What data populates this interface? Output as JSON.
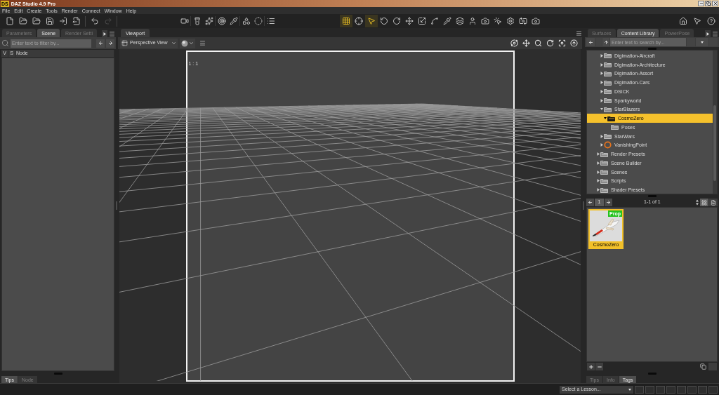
{
  "window": {
    "logo": "DS",
    "title": "DAZ Studio 4.9 Pro"
  },
  "menu": [
    "File",
    "Edit",
    "Create",
    "Tools",
    "Render",
    "Connect",
    "Window",
    "Help"
  ],
  "toolbar": {
    "history": [
      {
        "kind": "undo",
        "disabled": false
      },
      {
        "kind": "redo",
        "disabled": true
      }
    ],
    "tools": [
      {
        "selected": true
      },
      {
        "selected": false
      },
      {
        "selected": true
      },
      {
        "selected": false
      },
      {
        "selected": false
      },
      {
        "selected": false
      },
      {
        "selected": false
      },
      {
        "selected": false
      },
      {
        "selected": false
      },
      {
        "selected": false
      },
      {
        "selected": false
      },
      {
        "selected": false
      },
      {
        "selected": false
      },
      {
        "selected": false
      },
      {
        "selected": false
      },
      {
        "selected": false
      }
    ]
  },
  "scene_pane": {
    "tabs": [
      {
        "label": "Parameters",
        "selected": false
      },
      {
        "label": "Scene",
        "selected": true
      },
      {
        "label": "Render Setti",
        "selected": false
      }
    ],
    "search": {
      "placeholder": "Enter text to filter by..."
    },
    "columns": [
      "V",
      "S",
      "Node"
    ],
    "bottom_tabs": [
      {
        "label": "Tips",
        "selected": true
      },
      {
        "label": "Node",
        "selected": false
      }
    ]
  },
  "viewport": {
    "tab": "Viewport",
    "view": "Perspective View",
    "frame_label": "1 : 1"
  },
  "content_library": {
    "tabs": [
      {
        "label": "Surfaces",
        "selected": false
      },
      {
        "label": "Content Library",
        "selected": true
      },
      {
        "label": "PowerPose",
        "selected": false
      }
    ],
    "search": {
      "placeholder": "Enter text to search by..."
    },
    "tree": [
      {
        "children": [
          {
            "label": "Digimation-Aircraft",
            "kind": "folder",
            "expanded": false,
            "selected": false
          },
          {
            "label": "Digimation-Architecture",
            "kind": "folder",
            "expanded": false,
            "selected": false
          },
          {
            "label": "Digimation-Assort",
            "kind": "folder",
            "expanded": false,
            "selected": false
          },
          {
            "label": "Digimation-Cars",
            "kind": "folder",
            "expanded": false,
            "selected": false
          },
          {
            "label": "DSICK",
            "kind": "folder",
            "expanded": false,
            "selected": false
          },
          {
            "label": "Sparkyworld",
            "kind": "folder",
            "expanded": false,
            "selected": false
          },
          {
            "label": "StarBlazers",
            "kind": "folder",
            "expanded": true,
            "selected": false,
            "children": [
              {
                "label": "CosmoZero",
                "kind": "folder",
                "expanded": true,
                "selected": true,
                "children": [
                  {
                    "label": "Poses",
                    "kind": "folder",
                    "selected": false
                  }
                ]
              }
            ]
          },
          {
            "label": "StarWars",
            "kind": "folder",
            "expanded": false,
            "selected": false
          },
          {
            "label": "VanishingPoint",
            "kind": "product",
            "expanded": false,
            "selected": false
          }
        ]
      },
      {
        "label": "Render Presets",
        "kind": "folder",
        "expanded": false,
        "selected": false
      },
      {
        "label": "Scene Builder",
        "kind": "folder",
        "expanded": false,
        "selected": false
      },
      {
        "label": "Scenes",
        "kind": "folder",
        "expanded": false,
        "selected": false
      },
      {
        "label": "Scripts",
        "kind": "folder",
        "expanded": false,
        "selected": false
      },
      {
        "label": "Shader Presets",
        "kind": "folder",
        "expanded": false,
        "selected": false
      }
    ],
    "pager": {
      "page": "1",
      "range": "1-1 of 1"
    },
    "view_modes": [
      {
        "kind": "grid",
        "selected": true
      },
      {
        "kind": "list",
        "selected": false
      }
    ],
    "items": [
      {
        "label": "CosmoZero",
        "badge": "Prop",
        "selected": true
      }
    ],
    "bottom_tabs": [
      {
        "label": "Tips",
        "selected": false
      },
      {
        "label": "Info",
        "selected": false
      },
      {
        "label": "Tags",
        "selected": true
      }
    ]
  },
  "status_bar": {
    "lesson": "Select a Lesson..."
  }
}
